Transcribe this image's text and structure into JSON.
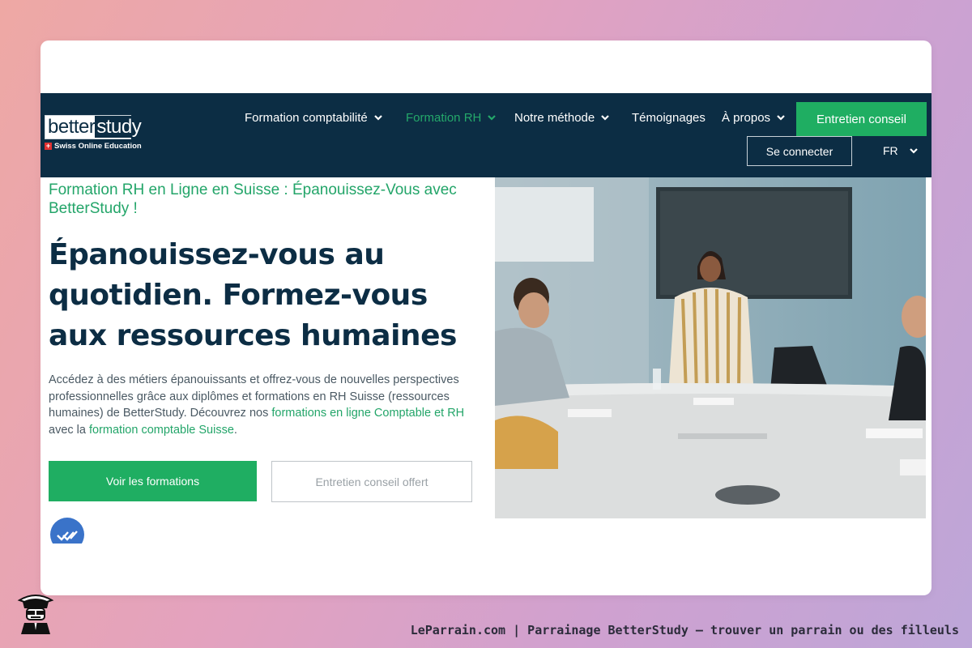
{
  "nav": {
    "logo_word_part1": "better",
    "logo_word_part2": "study",
    "logo_tagline": "Swiss Online Education",
    "items": [
      {
        "label": "Formation comptabilité",
        "has_dropdown": true,
        "active": false
      },
      {
        "label": "Formation RH",
        "has_dropdown": true,
        "active": true
      },
      {
        "label": "Notre méthode",
        "has_dropdown": true,
        "active": false
      },
      {
        "label": "Témoignages",
        "has_dropdown": false,
        "active": false
      },
      {
        "label": "À propos",
        "has_dropdown": true,
        "active": false
      }
    ],
    "cta_label": "Entretien conseil",
    "login_label": "Se connecter",
    "language": "FR"
  },
  "hero": {
    "subtitle": "Formation RH en Ligne en Suisse : Épanouissez-Vous avec BetterStudy !",
    "headline": "Épanouissez-vous au quotidien. Formez-vous aux ressources humaines",
    "paragraph": {
      "text_1": "Accédez à des métiers épanouissants et offrez-vous de nouvelles perspectives professionnelles grâce aux diplômes et formations en RH Suisse (ressources humaines) de BetterStudy. Découvrez nos ",
      "link_1": "formations en ligne Comptable et RH",
      "text_2": " avec la ",
      "link_2": "formation comptable Suisse",
      "text_3": "."
    },
    "primary_button": "Voir les formations",
    "secondary_button": "Entretien conseil offert"
  },
  "footer": {
    "caption": "LeParrain.com | Parrainage BetterStudy — trouver un parrain ou des filleuls"
  },
  "colors": {
    "navy": "#0c2d44",
    "green": "#1fae62",
    "link_green": "#23a569"
  },
  "icons": [
    "chevron-down-icon",
    "swiss-flag-icon",
    "check-badge-icon",
    "mascot-icon"
  ]
}
